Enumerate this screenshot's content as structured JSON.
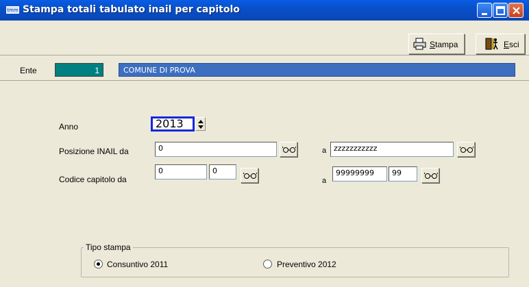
{
  "window": {
    "app_icon_text": "tmm",
    "title": "Stampa totali tabulato inail per capitolo",
    "controls": [
      "minimize-icon",
      "maximize-icon",
      "close-icon"
    ]
  },
  "toolbar": {
    "stampa_label": "Stampa",
    "esci_label": "Esci"
  },
  "ente": {
    "label": "Ente",
    "code": "1",
    "name": "COMUNE DI PROVA"
  },
  "form": {
    "anno_label": "Anno",
    "anno_value": "2013",
    "posizione_label": "Posizione INAIL da",
    "posizione_da": "0",
    "posizione_a_label": "a",
    "posizione_a": "zzzzzzzzzzz",
    "codice_label": "Codice capitolo da",
    "codice_da_1": "0",
    "codice_da_2": "0",
    "codice_a_label": "a",
    "codice_a_1": "99999999",
    "codice_a_2": "99"
  },
  "tipo_stampa": {
    "legend": "Tipo stampa",
    "options": [
      {
        "label": "Consuntivo 2011",
        "selected": true
      },
      {
        "label": "Preventivo 2012",
        "selected": false
      }
    ]
  },
  "colors": {
    "title_bar": "#0a5de6",
    "ente_code_bg": "#008080",
    "ente_name_bg": "#3d6fc0",
    "focus_border": "#1326e0"
  }
}
